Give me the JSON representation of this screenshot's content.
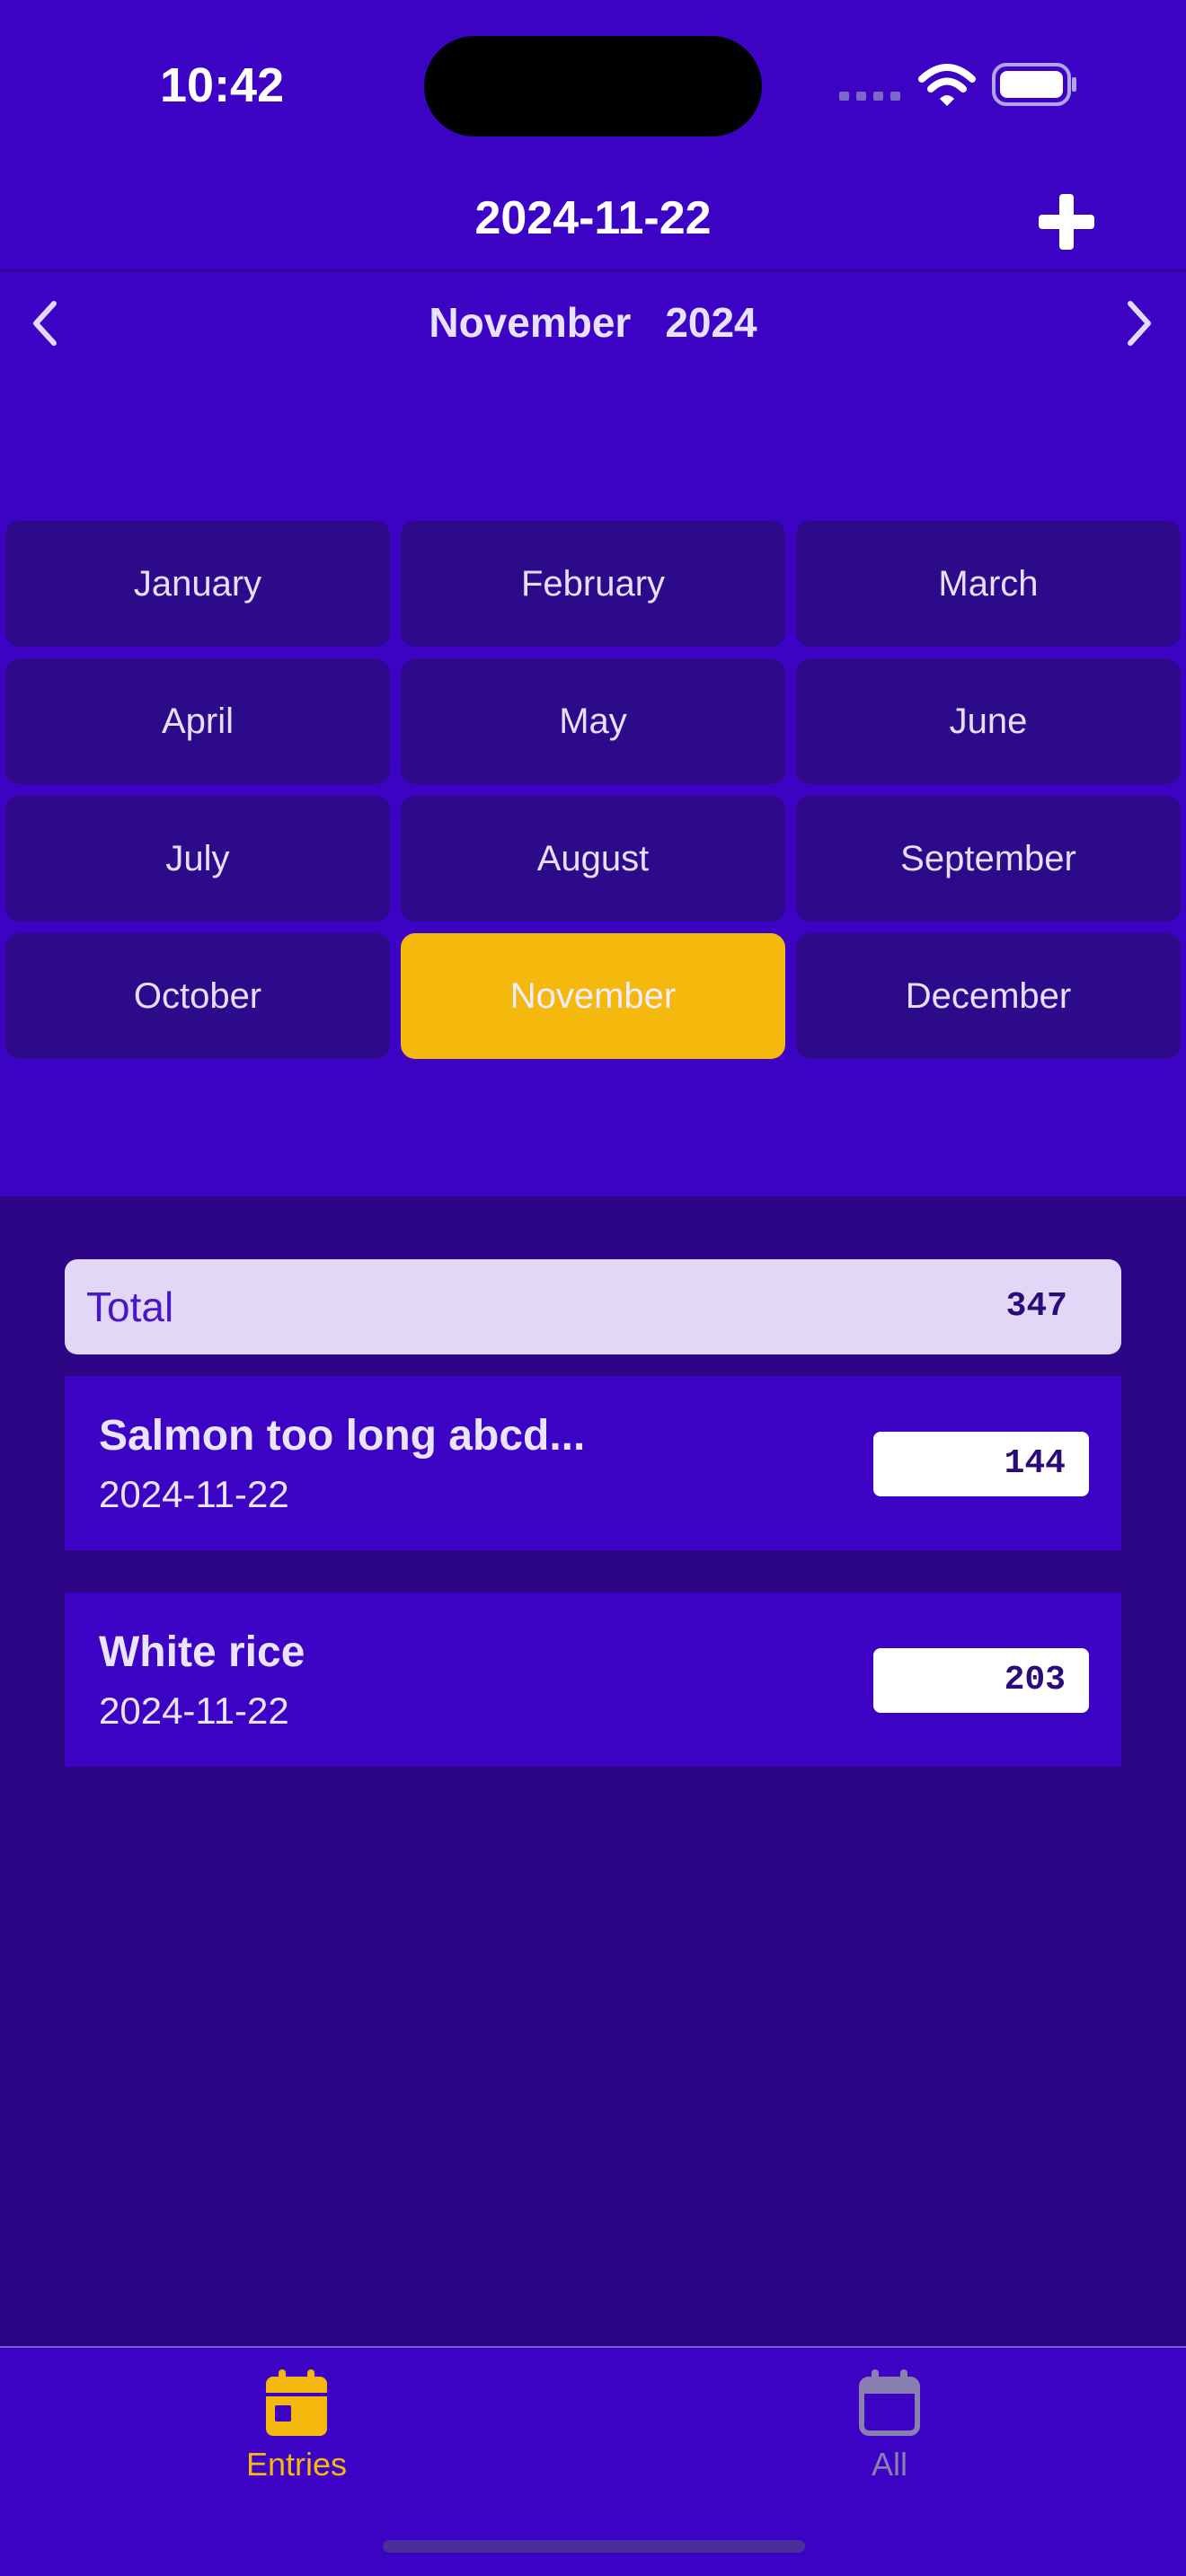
{
  "status_bar": {
    "time": "10:42"
  },
  "header": {
    "title": "2024-11-22",
    "add_icon": "plus-icon"
  },
  "calendar": {
    "month": "November",
    "year": "2024",
    "prev_icon": "chevron-left-icon",
    "next_icon": "chevron-right-icon",
    "months": [
      "January",
      "February",
      "March",
      "April",
      "May",
      "June",
      "July",
      "August",
      "September",
      "October",
      "November",
      "December"
    ],
    "selected_month": "November"
  },
  "summary": {
    "label": "Total",
    "value": "347"
  },
  "entries": [
    {
      "name": "Salmon too long abcd...",
      "date": "2024-11-22",
      "value": "144"
    },
    {
      "name": "White rice",
      "date": "2024-11-22",
      "value": "203"
    }
  ],
  "tabs": [
    {
      "label": "Entries",
      "icon": "calendar-icon",
      "active": true
    },
    {
      "label": "All",
      "icon": "calendar-outline-icon",
      "active": false
    }
  ],
  "colors": {
    "background": "#3c03c4",
    "content_background": "#2c0685",
    "accent": "#f5b90d",
    "inactive": "#8a80b0"
  }
}
